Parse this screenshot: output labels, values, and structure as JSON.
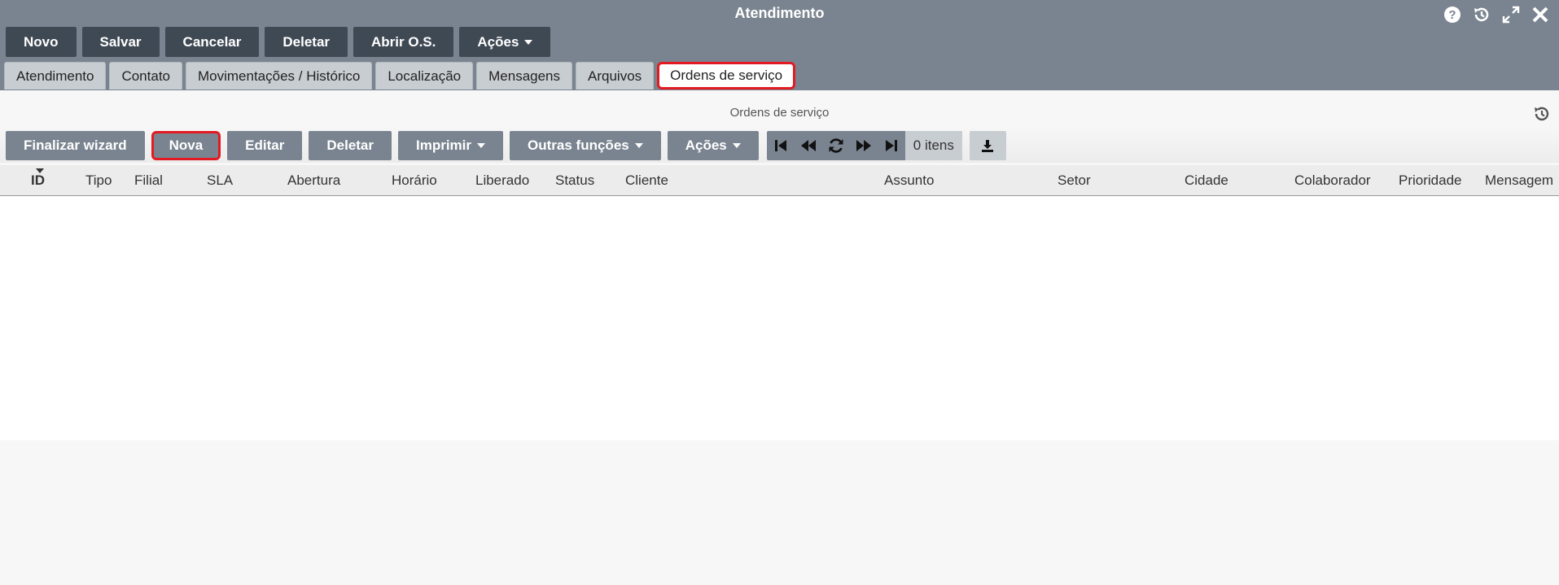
{
  "window": {
    "title": "Atendimento",
    "controls": [
      "help-icon",
      "history-icon",
      "expand-icon",
      "close-icon"
    ]
  },
  "toolbar": {
    "buttons": [
      "Novo",
      "Salvar",
      "Cancelar",
      "Deletar",
      "Abrir O.S."
    ],
    "actions_label": "Ações"
  },
  "tabs": [
    "Atendimento",
    "Contato",
    "Movimentações / Histórico",
    "Localização",
    "Mensagens",
    "Arquivos",
    "Ordens de serviço"
  ],
  "active_tab": "Ordens de serviço",
  "panel": {
    "title": "Ordens de serviço",
    "grid_toolbar": {
      "finalize": "Finalizar wizard",
      "new": "Nova",
      "edit": "Editar",
      "delete": "Deletar",
      "print": "Imprimir",
      "other_functions": "Outras funções",
      "actions": "Ações",
      "item_count": "0 itens"
    },
    "columns": [
      "ID",
      "Tipo",
      "Filial",
      "SLA",
      "Abertura",
      "Horário",
      "Liberado",
      "Status",
      "Cliente",
      "Assunto",
      "Setor",
      "Cidade",
      "Colaborador",
      "Prioridade",
      "Mensagem"
    ],
    "sorted_column": "ID",
    "rows": []
  },
  "colors": {
    "header_bg": "#7a8490",
    "dark_button": "#3f4954",
    "highlight": "#e21b23"
  }
}
